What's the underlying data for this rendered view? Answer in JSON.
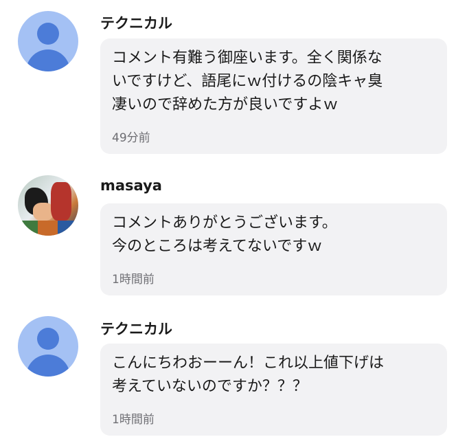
{
  "comments": [
    {
      "author": "テクニカル",
      "avatar_icon": "default-user-icon",
      "lines": [
        "コメント有難う御座います。全く関係な",
        "いですけど、語尾にｗ付けるの陰キャ臭",
        "凄いので辞めた方が良いですよｗ"
      ],
      "time": "49分前"
    },
    {
      "author": "masaya",
      "avatar_icon": "user-photo-avatar",
      "lines": [
        "コメントありがとうございます。",
        "今のところは考えてないですｗ"
      ],
      "time": "1時間前"
    },
    {
      "author": "テクニカル",
      "avatar_icon": "default-user-icon",
      "lines": [
        "こんにちわおーーん！これ以上値下げは",
        "考えていないのですか？？？"
      ],
      "time": "1時間前"
    }
  ],
  "colors": {
    "avatar_bg": "#a4c1f4",
    "avatar_fg": "#4c7cd8",
    "bubble_bg": "#f2f2f4",
    "time_text": "#6e6e73"
  }
}
